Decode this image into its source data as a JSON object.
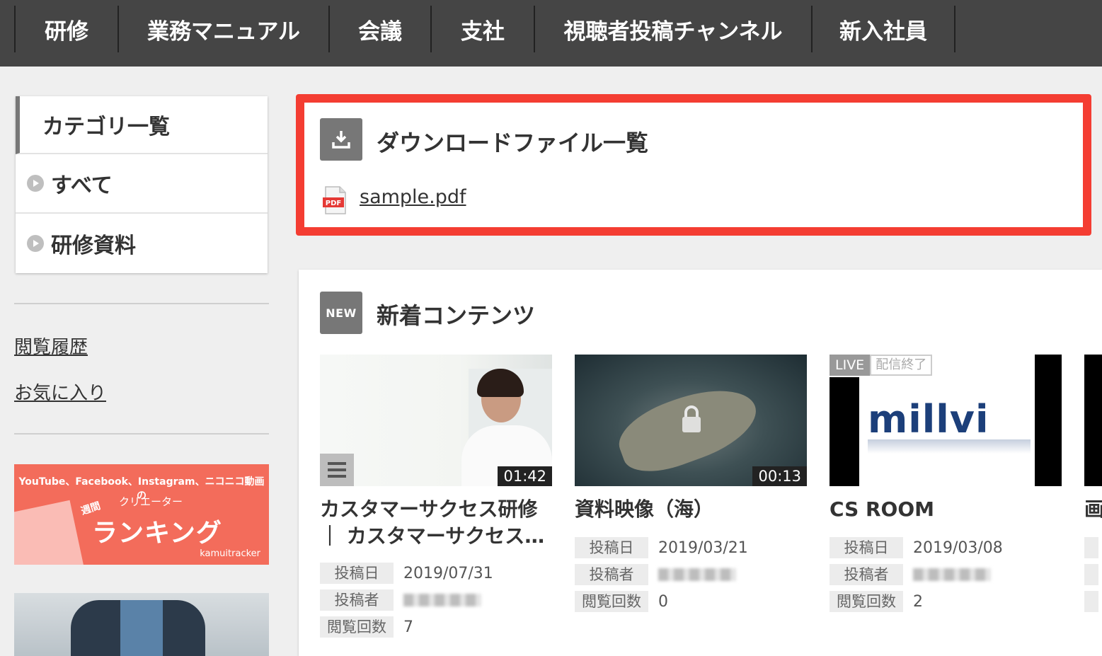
{
  "nav": {
    "items": [
      "研修",
      "業務マニュアル",
      "会議",
      "支社",
      "視聴者投稿チャンネル",
      "新入社員"
    ]
  },
  "sidebar": {
    "category_title": "カテゴリ一覧",
    "categories": [
      "すべて",
      "研修資料"
    ],
    "links": [
      "閲覧履歴",
      "お気に入り"
    ],
    "banner": {
      "top_text": "YouTube、Facebook、Instagram、ニコニコ動画の",
      "week": "週間",
      "sub": "クリエーター",
      "main": "ランキング",
      "brand": "kamuitracker"
    }
  },
  "download": {
    "title": "ダウンロードファイル一覧",
    "file": "sample.pdf",
    "pdf_badge": "PDF",
    "highlight_color": "#f43d32"
  },
  "new_contents": {
    "badge": "NEW",
    "title": "新着コンテンツ",
    "meta_labels": {
      "date": "投稿日",
      "author": "投稿者",
      "views": "閲覧回数"
    },
    "cards": [
      {
        "title_line1": "カスタマーサクセス研修",
        "title_line2": "｜ カスタマーサクセス…",
        "duration": "01:42",
        "date": "2019/07/31",
        "views": "7"
      },
      {
        "title_line1": "資料映像（海）",
        "duration": "00:13",
        "date": "2019/03/21",
        "views": "0"
      },
      {
        "title_line1": "CS ROOM",
        "live": "LIVE",
        "live_status": "配信終了",
        "logo": "millvi",
        "date": "2019/03/08",
        "views": "2"
      },
      {
        "title_line1": "画"
      }
    ]
  }
}
